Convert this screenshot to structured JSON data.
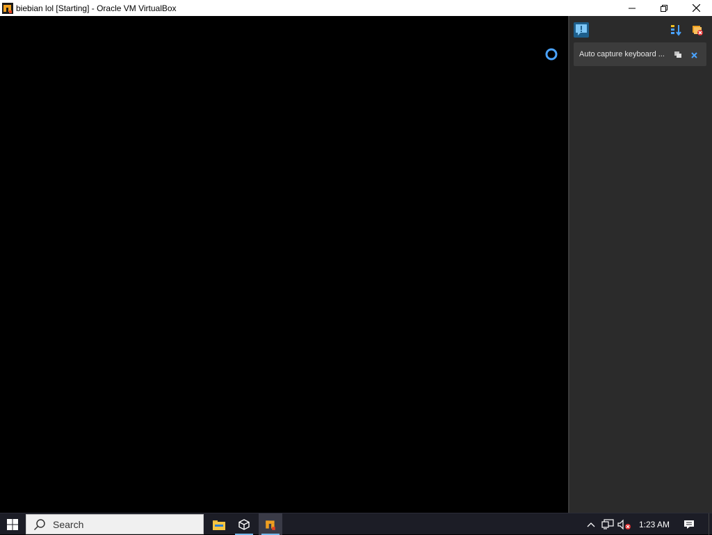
{
  "window": {
    "title": "biebian lol [Starting] - Oracle VM VirtualBox",
    "app_icon": "virtualbox-vm-icon",
    "controls": [
      "minimize-icon",
      "restore-icon",
      "close-icon"
    ]
  },
  "vm": {
    "state": "Starting",
    "loading_indicator": "loading-spinner-icon"
  },
  "notification_panel": {
    "toggle_icon": "notifications-toggle-icon",
    "sort_icon": "sort-icon",
    "clear_icon": "clear-all-icon",
    "item": {
      "text": "Auto capture keyboard ...",
      "help_icon": "help-icon",
      "close_icon": "close-icon"
    }
  },
  "taskbar": {
    "search_placeholder": "Search",
    "apps": [
      "file-explorer-icon",
      "virtualbox-manager-icon",
      "virtualbox-vm-icon"
    ],
    "tray": [
      "show-hidden-icons-chevron-icon",
      "network-icon",
      "volume-muted-icon"
    ],
    "time": "1:23 AM",
    "action_center_icon": "action-center-icon"
  },
  "colors": {
    "taskbar_bg": "#1c1d26",
    "panel_bg": "#2b2b2b",
    "notification_bg": "#3c3c3c",
    "accent_blue": "#4aa3ff",
    "vbox_orange": "#f0a020"
  }
}
